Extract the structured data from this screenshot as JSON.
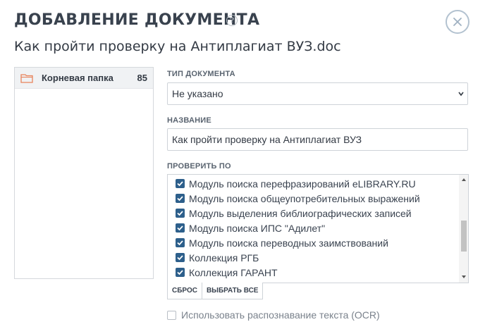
{
  "dialog": {
    "title": "ДОБАВЛЕНИЕ ДОКУМЕНТА",
    "help_glyph": "?",
    "subtitle": "Как пройти проверку на Антиплагиат ВУЗ.doc"
  },
  "folders": [
    {
      "label": "Корневая папка",
      "count": "85",
      "icon": "folder-icon"
    }
  ],
  "doc_type": {
    "label": "ТИП ДОКУМЕНТА",
    "value": "Не указано"
  },
  "name_field": {
    "label": "НАЗВАНИЕ",
    "value": "Как пройти проверку на Антиплагиат ВУЗ"
  },
  "check_by": {
    "label": "ПРОВЕРИТЬ ПО",
    "items": [
      {
        "label": "Модуль поиска перефразирований eLIBRARY.RU",
        "checked": true
      },
      {
        "label": "Модуль поиска общеупотребительных выражений",
        "checked": true
      },
      {
        "label": "Модуль выделения библиографических записей",
        "checked": true
      },
      {
        "label": "Модуль поиска ИПС \"Адилет\"",
        "checked": true
      },
      {
        "label": "Модуль поиска переводных заимствований",
        "checked": true
      },
      {
        "label": "Коллекция РГБ",
        "checked": true
      },
      {
        "label": "Коллекция ГАРАНТ",
        "checked": true
      }
    ],
    "reset_label": "СБРОС",
    "select_all_label": "ВЫБРАТЬ ВСЕ"
  },
  "ocr": {
    "label": "Использовать распознавание текста (OCR)",
    "checked": false
  },
  "colors": {
    "accent": "#2d5f8b",
    "folder_icon": "#e8825a",
    "close_ring": "#b3c2d0"
  }
}
